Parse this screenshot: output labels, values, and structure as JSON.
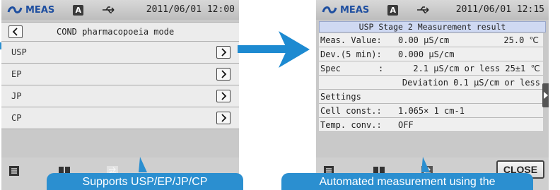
{
  "left_screen": {
    "status": {
      "brand": "MEAS",
      "mode_badge": "A",
      "datetime": "2011/06/01 12:00"
    },
    "title": "COND pharmacopoeia mode",
    "menu_items": [
      {
        "label": "USP"
      },
      {
        "label": "EP"
      },
      {
        "label": "JP"
      },
      {
        "label": "CP"
      }
    ],
    "callout": "Supports USP/EP/JP/CP"
  },
  "right_screen": {
    "status": {
      "brand": "MEAS",
      "mode_badge": "A",
      "datetime": "2011/06/01 12:15"
    },
    "title": "USP Stage 2 Measurement result",
    "rows": [
      {
        "label": "Meas. Value:",
        "value": "0.00 μS/cm",
        "extra": "25.0 ℃"
      },
      {
        "label": "Dev.(5 min):",
        "value": "0.000 μS/cm",
        "extra": ""
      },
      {
        "label": "Spec",
        "sep": ":",
        "value": "2.1 μS/cm or less 25±1 ℃",
        "extra": ""
      },
      {
        "label": "",
        "value": "Deviation  0.1 μS/cm or less",
        "extra": ""
      },
      {
        "label": "Settings",
        "value": "",
        "extra": ""
      },
      {
        "label": "Cell const.:",
        "value": "1.065×   1  cm-1",
        "extra": ""
      },
      {
        "label": "Temp. conv.:",
        "value": "OFF",
        "extra": ""
      }
    ],
    "close_label": "CLOSE",
    "callout": "Automated measurement using the"
  },
  "colors": {
    "accent": "#2b8fd0",
    "screen_bg": "#c9c9c9",
    "title_highlight": "#cfd9f2"
  },
  "icons": [
    "meas-logo-icon",
    "usb-icon",
    "back-icon",
    "chevron-right-icon",
    "menu-list-icon",
    "book-icon",
    "transfer-icon",
    "arrow-pointer-icon"
  ]
}
